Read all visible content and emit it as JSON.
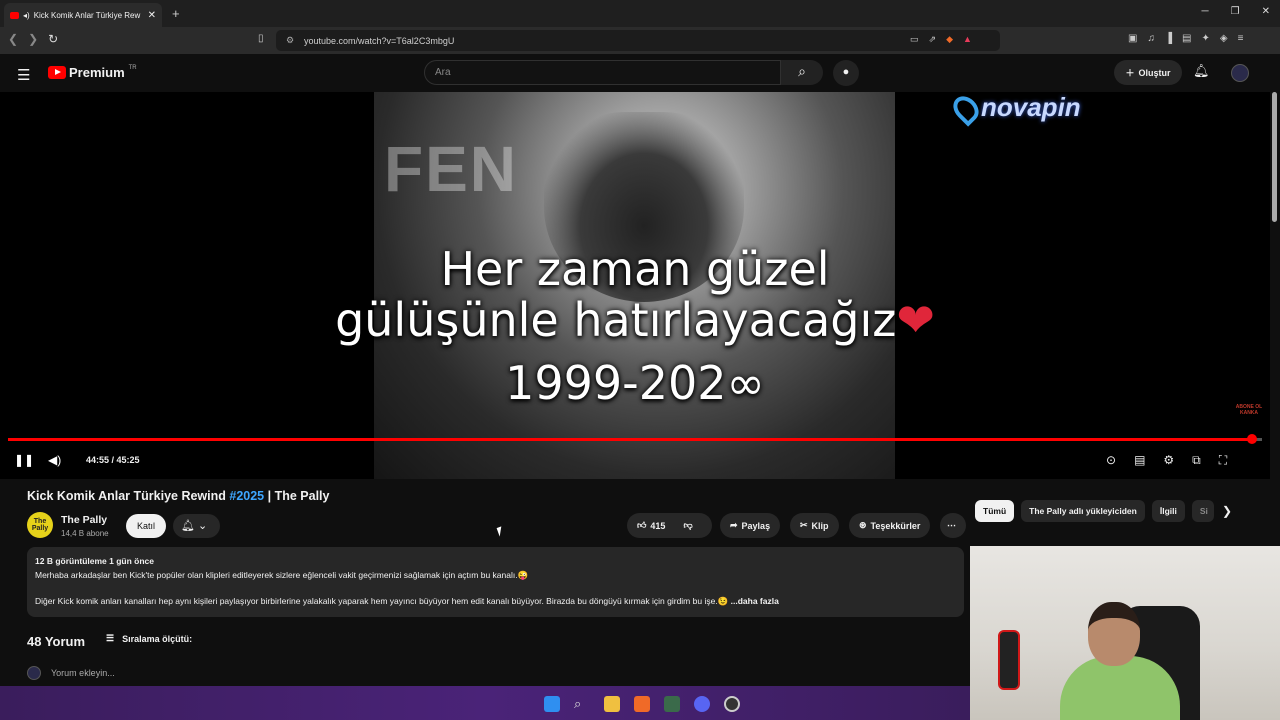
{
  "browser": {
    "tab_title": "Kick Komik Anlar Türkiye Rew",
    "url": "youtube.com/watch?v=T6al2C3mbgU"
  },
  "header": {
    "logo": "Premium",
    "region": "TR",
    "search_placeholder": "Ara",
    "create_label": "Oluştur"
  },
  "video": {
    "overlay_line1": "Her zaman güzel",
    "overlay_line2": "gülüşünle hatırlayacağız",
    "overlay_line3": "1999-202∞",
    "photo_text": "FEN",
    "watermark": "novapin",
    "abone_text": "ABONE OL KANKA",
    "progress": 0.992,
    "time": "44:55 / 45:25"
  },
  "meta": {
    "title_prefix": "Kick Komik Anlar Türkiye Rewind ",
    "title_tag": "#2025",
    "title_suffix": " | The Pally",
    "channel": "The Pally",
    "subscribers": "14,4 B abone",
    "avatar_text": "The Pally",
    "join": "Katıl",
    "likes": "415",
    "share": "Paylaş",
    "clip": "Klip",
    "thanks": "Teşekkürler"
  },
  "chips": [
    "Tümü",
    "The Pally adlı yükleyiciden",
    "İlgili",
    "Si"
  ],
  "description": {
    "meta": "12 B görüntüleme  1 gün önce",
    "line1": "Merhaba arkadaşlar ben Kick'te popüler olan klipleri editleyerek sizlere eğlenceli vakit geçirmenizi sağlamak için açtım bu kanalı.😜",
    "line2": "Diğer Kick komik anları kanalları hep aynı kişileri paylaşıyor birbirlerine yalakalık yaparak hem yayıncı büyüyor hem edit kanalı büyüyor. Birazda bu döngüyü kırmak için girdim bu işe.😉",
    "more": "...daha fazla"
  },
  "comments": {
    "count": "48 Yorum",
    "sort": "Sıralama ölçütü:",
    "add_placeholder": "Yorum ekleyin..."
  }
}
